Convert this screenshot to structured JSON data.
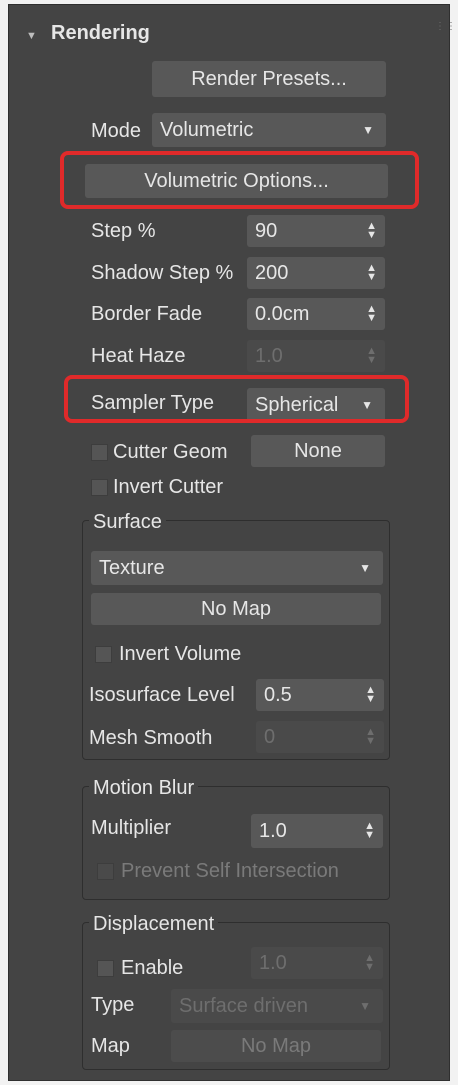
{
  "header": {
    "title": "Rendering",
    "grip_icon": "grip-dots-icon",
    "collapse_icon": "triangle-down-icon"
  },
  "render_presets_label": "Render Presets...",
  "mode": {
    "label": "Mode",
    "value": "Volumetric"
  },
  "volumetric_options_label": "Volumetric Options...",
  "step": {
    "label": "Step %",
    "value": "90"
  },
  "shadow_step": {
    "label": "Shadow Step %",
    "value": "200"
  },
  "border_fade": {
    "label": "Border Fade",
    "value": "0.0cm"
  },
  "heat_haze": {
    "label": "Heat Haze",
    "value": "1.0"
  },
  "sampler_type": {
    "label": "Sampler Type",
    "value": "Spherical"
  },
  "cutter_geom": {
    "label": "Cutter Geom",
    "button": "None"
  },
  "invert_cutter": {
    "label": "Invert Cutter"
  },
  "surface": {
    "title": "Surface",
    "type_value": "Texture",
    "map_button": "No Map",
    "invert_volume": "Invert Volume",
    "iso_label": "Isosurface Level",
    "iso_value": "0.5",
    "mesh_smooth_label": "Mesh Smooth",
    "mesh_smooth_value": "0"
  },
  "motion_blur": {
    "title": "Motion Blur",
    "multiplier_label": "Multiplier",
    "multiplier_value": "1.0",
    "prevent_label": "Prevent Self Intersection"
  },
  "displacement": {
    "title": "Displacement",
    "enable_label": "Enable",
    "enable_value": "1.0",
    "type_label": "Type",
    "type_value": "Surface driven",
    "map_label": "Map",
    "map_button": "No Map"
  },
  "colors": {
    "panel": "#444444",
    "highlight": "#e02a2a",
    "control": "#585858"
  }
}
